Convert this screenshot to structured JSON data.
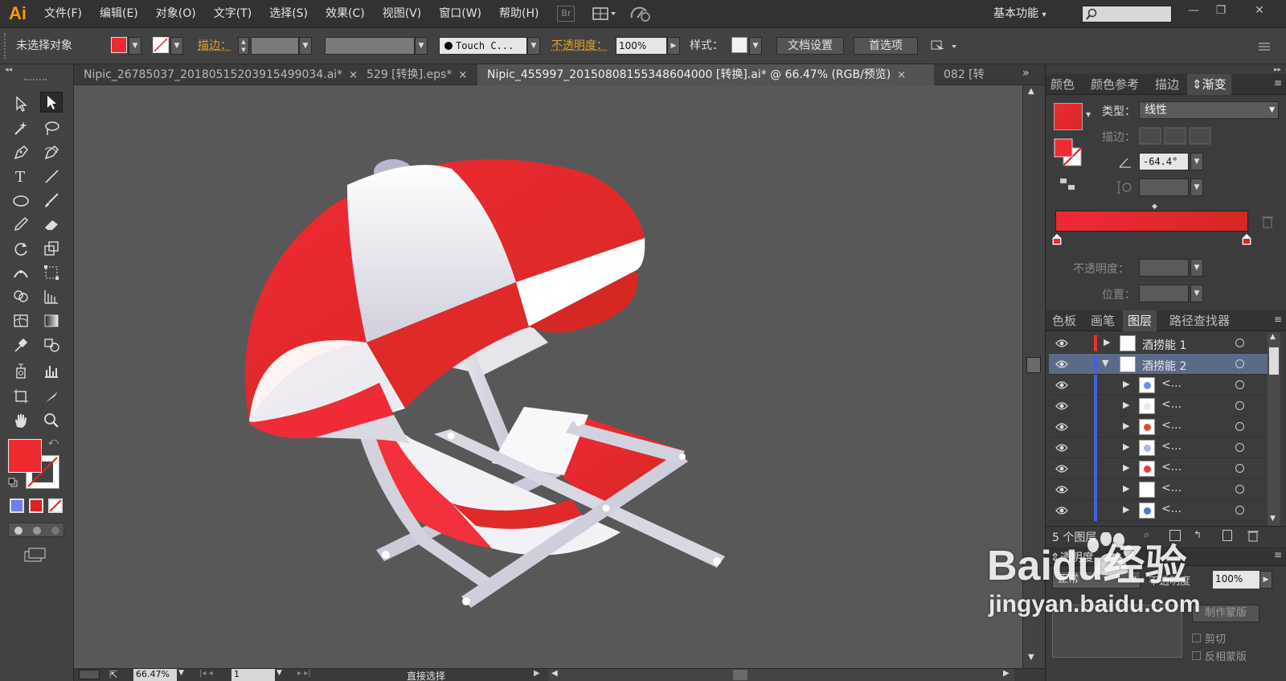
{
  "app": {
    "logo": "Ai"
  },
  "menu": [
    "文件(F)",
    "编辑(E)",
    "对象(O)",
    "文字(T)",
    "选择(S)",
    "效果(C)",
    "视图(V)",
    "窗口(W)",
    "帮助(H)"
  ],
  "menubar": {
    "bridge_label": "Br",
    "workspace": "基本功能"
  },
  "controlbar": {
    "selection_status": "未选择对象",
    "stroke_label": "描边：",
    "brush_name": "Touch C...",
    "opacity_label": "不透明度：",
    "opacity_value": "100%",
    "style_label": "样式：",
    "doc_setup": "文档设置",
    "preferences": "首选项"
  },
  "tabs": [
    {
      "label": "Nipic_26785037_20180515203915499034.ai*",
      "active": false
    },
    {
      "label": "529 [转换].eps*",
      "active": false
    },
    {
      "label": "Nipic_455997_20150808155348604000 [转换].ai* @ 66.47% (RGB/预览)",
      "active": true
    },
    {
      "label": "082 [转",
      "active": false
    }
  ],
  "status": {
    "zoom": "66.47%",
    "page": "1",
    "tool_hint": "直接选择"
  },
  "gradient_panel": {
    "tabs": [
      "颜色",
      "颜色参考",
      "描边",
      "渐变"
    ],
    "type_label": "类型：",
    "type_value": "线性",
    "stroke_label": "描边：",
    "angle_value": "-64.4°",
    "opacity_label": "不透明度：",
    "position_label": "位置：",
    "start_color": "#ee2a35",
    "end_color": "#d62822"
  },
  "layers_panel": {
    "tabs": [
      "色板",
      "画笔",
      "图层",
      "路径查找器"
    ],
    "layers": [
      {
        "name": "酒捞能 1",
        "expanded": false
      },
      {
        "name": "酒捞能 2",
        "expanded": true
      }
    ],
    "sublayer_label": "<...",
    "sublayer_count": 7,
    "footer": "5 个图层"
  },
  "transparency_panel": {
    "title": "透明度",
    "mode": "正常",
    "opacity_label": "不透明度",
    "opacity_value": "100%",
    "make_mask": "制作蒙版",
    "clip": "剪切",
    "invert_mask": "反相蒙版"
  },
  "watermark": {
    "brand": "Baidu经验",
    "url": "jingyan.baidu.com"
  }
}
